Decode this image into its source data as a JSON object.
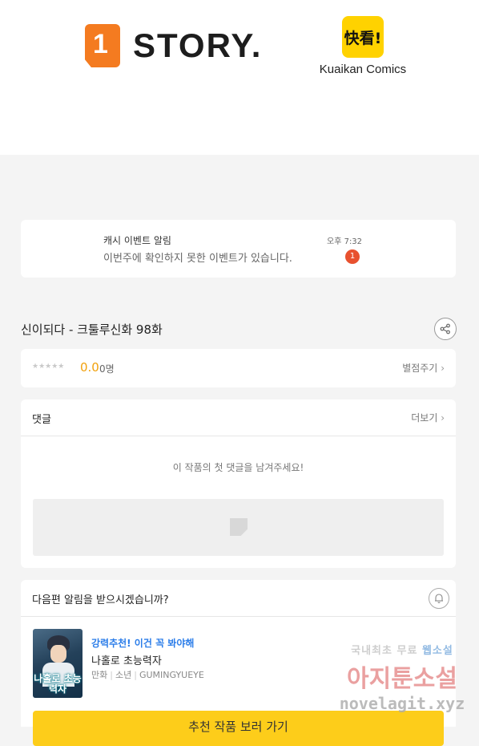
{
  "header": {
    "logo_story": "STORY.",
    "logo_kuaikan_badge": "快看!",
    "logo_kuaikan_text": "Kuaikan Comics"
  },
  "event": {
    "title": "캐시 이벤트 알림",
    "message": "이번주에 확인하지 못한 이벤트가 있습니다.",
    "time": "오후 7:32",
    "badge_count": "1"
  },
  "episode": {
    "title": "신이되다 - 크툴루신화 98화"
  },
  "rating": {
    "stars": "★★★★★",
    "score": "0.0",
    "count": "0명",
    "rate_label": "별점주기"
  },
  "comments": {
    "title": "댓글",
    "more_label": "더보기",
    "empty_message": "이 작품의 첫 댓글을 남겨주세요!"
  },
  "next_notice": {
    "question": "다음편 알림을 받으시겠습니까?"
  },
  "recommendation": {
    "tag": "강력추천! 이건 꼭 봐야해",
    "name": "나홀로 초능력자",
    "cover_text": "나홀로 초능력자",
    "genre": "만화",
    "category": "소년",
    "author": "GUMINGYUEYE",
    "button_label": "추천 작품 보러 가기"
  },
  "watermark": {
    "line1": "국내최초 무료",
    "line1_highlight": "웹소설",
    "line2": "아지툰소설",
    "line3": "novelagit.xyz"
  },
  "colors": {
    "story_orange": "#f47b20",
    "kuaikan_yellow": "#ffd200",
    "score": "#f1a10d",
    "badge_red": "#e8512f",
    "rec_tag_blue": "#2b7de9",
    "cta_yellow": "#fdcd1a"
  }
}
